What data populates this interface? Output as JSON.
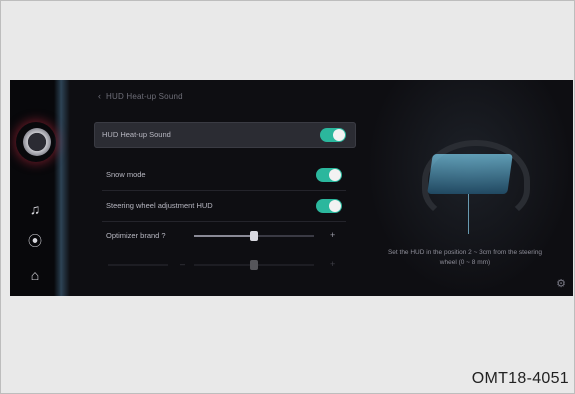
{
  "header": {
    "back_icon": "chevron-left-icon",
    "title": "HUD Heat-up Sound"
  },
  "rail": {
    "items": [
      {
        "icon": "music-note-icon",
        "glyph": "♫"
      },
      {
        "icon": "location-pin-icon",
        "glyph": "⦿"
      },
      {
        "icon": "home-icon",
        "glyph": "⌂"
      }
    ]
  },
  "settings": {
    "rows": [
      {
        "label": "HUD Heat-up Sound",
        "toggle_on": true
      },
      {
        "label": "Snow mode",
        "toggle_on": true
      },
      {
        "label": "Steering wheel adjustment HUD",
        "toggle_on": true
      }
    ],
    "sliders": [
      {
        "label": "Optimizer brand ?",
        "value": 0.5,
        "minus": "–",
        "plus": "+"
      },
      {
        "label": "",
        "value": 0.5,
        "minus": "–",
        "plus": "+"
      }
    ]
  },
  "preview": {
    "description": "Set the HUD in the position 2 ~ 3cm from the steering wheel (0 ~ 8 mm)",
    "settings_icon": "gear-icon"
  },
  "figure_code": "OMT18-4051",
  "colors": {
    "toggle_on": "#2bb79d",
    "screen_bg": "#0e0e12"
  }
}
